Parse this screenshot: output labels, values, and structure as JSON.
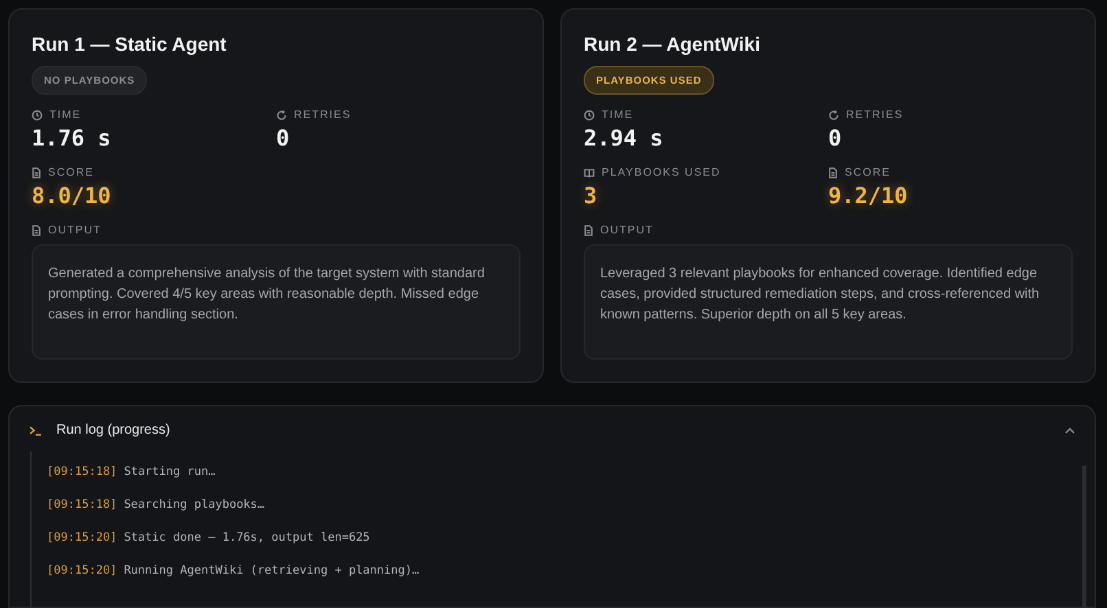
{
  "runs": [
    {
      "title": "Run 1 — Static Agent",
      "badge": {
        "label": "NO PLAYBOOKS",
        "active": false
      },
      "stats": [
        {
          "kind": "time",
          "label": "TIME",
          "value": "1.76 s",
          "accent": false
        },
        {
          "kind": "retries",
          "label": "RETRIES",
          "value": "0",
          "accent": false
        },
        {
          "kind": "score",
          "label": "SCORE",
          "value": "8.0/10",
          "accent": true
        }
      ],
      "output_label": "OUTPUT",
      "output": "Generated a comprehensive analysis of the target system with standard prompting. Covered 4/5 key areas with reasonable depth. Missed edge cases in error handling section."
    },
    {
      "title": "Run 2 — AgentWiki",
      "badge": {
        "label": "PLAYBOOKS USED",
        "active": true
      },
      "stats": [
        {
          "kind": "time",
          "label": "TIME",
          "value": "2.94 s",
          "accent": false
        },
        {
          "kind": "retries",
          "label": "RETRIES",
          "value": "0",
          "accent": false
        },
        {
          "kind": "playbooks",
          "label": "PLAYBOOKS USED",
          "value": "3",
          "accent": true
        },
        {
          "kind": "score",
          "label": "SCORE",
          "value": "9.2/10",
          "accent": true
        }
      ],
      "output_label": "OUTPUT",
      "output": "Leveraged 3 relevant playbooks for enhanced coverage. Identified edge cases, provided structured remediation steps, and cross-referenced with known patterns. Superior depth on all 5 key areas."
    }
  ],
  "log": {
    "title": "Run log (progress)",
    "expanded": true,
    "lines": [
      {
        "time": "[09:15:18]",
        "message": "Starting run…"
      },
      {
        "time": "[09:15:18]",
        "message": "Searching playbooks…"
      },
      {
        "time": "[09:15:20]",
        "message": "Static done — 1.76s, output len=625"
      },
      {
        "time": "[09:15:20]",
        "message": "Running AgentWiki (retrieving + planning)…"
      }
    ]
  }
}
